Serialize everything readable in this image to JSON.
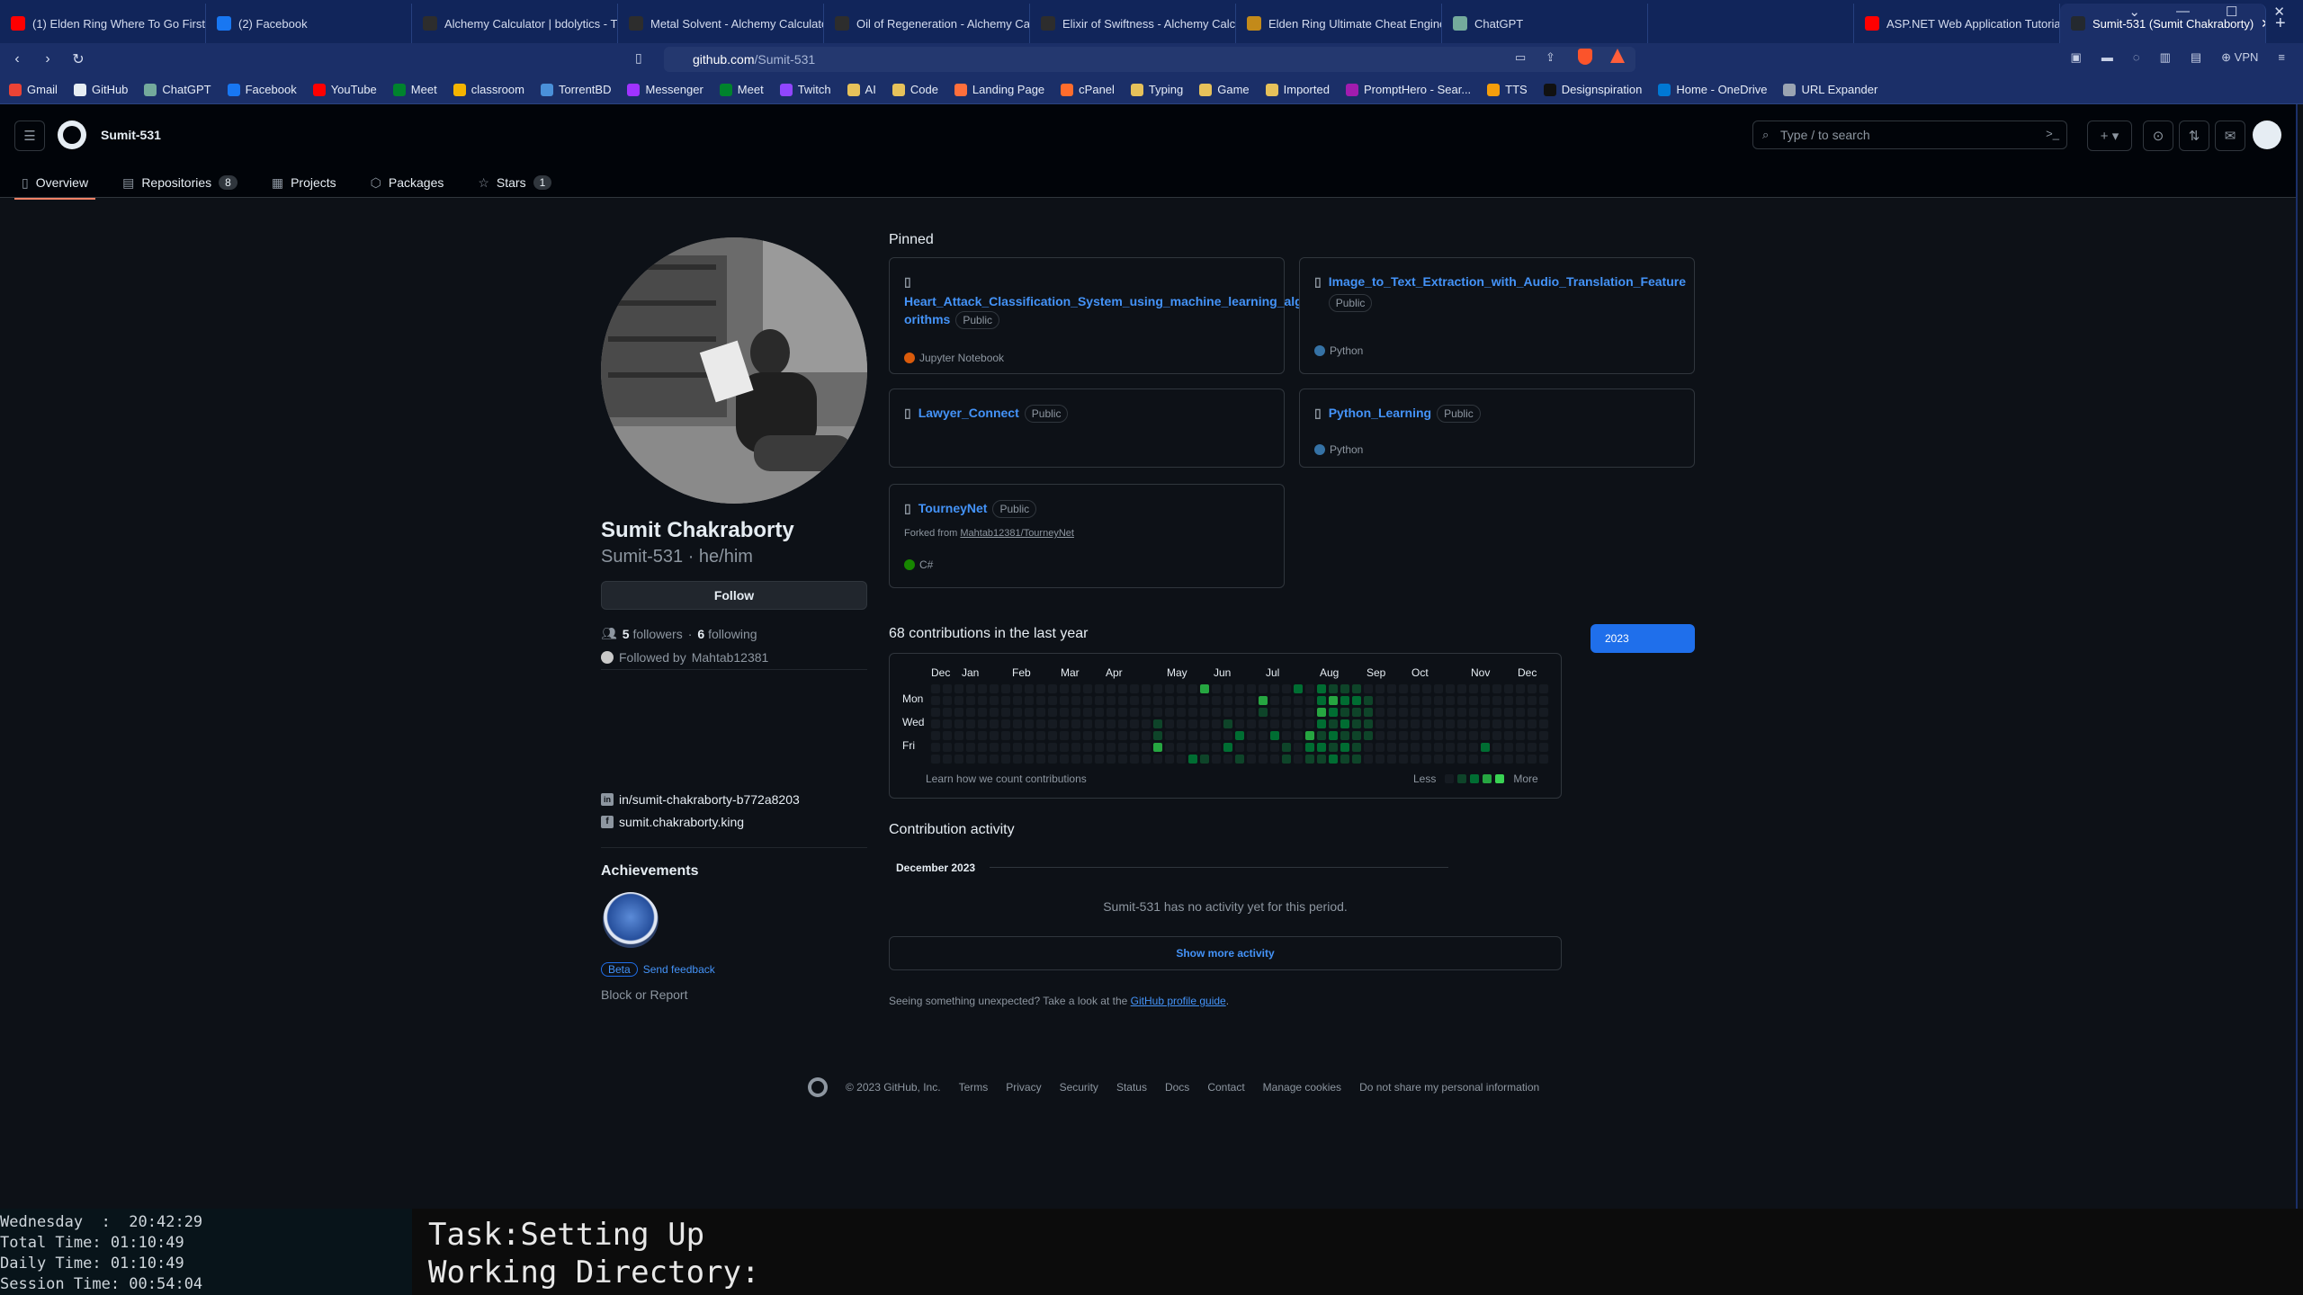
{
  "browser": {
    "tabs": [
      {
        "title": "(1) Elden Ring Where To Go First |",
        "favicon": "youtube-icon"
      },
      {
        "title": "(2) Facebook",
        "favicon": "facebook-icon"
      },
      {
        "title": "Alchemy Calculator | bdolytics - Th",
        "favicon": "bdolytics-icon"
      },
      {
        "title": "Metal Solvent - Alchemy Calculato",
        "favicon": "bdolytics-icon"
      },
      {
        "title": "Oil of Regeneration - Alchemy Cal",
        "favicon": "bdolytics-icon"
      },
      {
        "title": "Elixir of Swiftness - Alchemy Calcu",
        "favicon": "bdolytics-icon"
      },
      {
        "title": "Elden Ring Ultimate Cheat Engine",
        "favicon": "page-icon"
      },
      {
        "title": "ChatGPT",
        "favicon": "chatgpt-icon"
      },
      {
        "title": "",
        "favicon": ""
      },
      {
        "title": "ASP.NET Web Application Tutorial",
        "favicon": "youtube-icon"
      },
      {
        "title": "Sumit-531 (Sumit Chakraborty)",
        "favicon": "github-icon"
      }
    ],
    "url_host": "github.com",
    "url_path": "/Sumit-531",
    "vpn_label": "VPN",
    "bookmarks": [
      "Gmail",
      "GitHub",
      "ChatGPT",
      "Facebook",
      "YouTube",
      "Meet",
      "classroom",
      "TorrentBD",
      "Messenger",
      "Meet",
      "Twitch",
      "AI",
      "Code",
      "Landing Page",
      "cPanel",
      "Typing",
      "Game",
      "Imported",
      "PromptHero - Sear...",
      "TTS",
      "Designspiration",
      "Home - OneDrive",
      "URL Expander"
    ]
  },
  "github": {
    "username_top": "Sumit-531",
    "search_placeholder": "Type / to search",
    "tabs": [
      {
        "label": "Overview"
      },
      {
        "label": "Repositories",
        "count": "8"
      },
      {
        "label": "Projects"
      },
      {
        "label": "Packages"
      },
      {
        "label": "Stars",
        "count": "1"
      }
    ],
    "profile": {
      "fullname": "Sumit Chakraborty",
      "login": "Sumit-531 · he/him",
      "follow_label": "Follow",
      "followers_count": "5",
      "followers_label": "followers",
      "following_count": "6",
      "following_label": "following",
      "followed_by": "Followed by",
      "followed_by_user": "Mahtab12381",
      "linkedin": "in/sumit-chakraborty-b772a8203",
      "facebook": "sumit.chakraborty.king",
      "achievements_title": "Achievements",
      "beta_label": "Beta",
      "send_feedback": "Send feedback",
      "block_report": "Block or Report"
    },
    "pinned_title": "Pinned",
    "pinned": [
      {
        "name": "Heart_Attack_Classification_System_using_machine_learning_alg orithms",
        "visibility": "Public",
        "language": "Jupyter Notebook",
        "lang_color": "#da5b0b"
      },
      {
        "name": "Image_to_Text_Extraction_with_Audio_Translation_Feature",
        "visibility": "Public",
        "language": "Python",
        "lang_color": "#3572a5"
      },
      {
        "name": "Lawyer_Connect",
        "visibility": "Public",
        "language": "",
        "lang_color": ""
      },
      {
        "name": "Python_Learning",
        "visibility": "Public",
        "language": "Python",
        "lang_color": "#3572a5"
      },
      {
        "name": "TourneyNet",
        "visibility": "Public",
        "forked_label": "Forked from",
        "forked_from": "Mahtab12381/TourneyNet",
        "language": "C#",
        "lang_color": "#178600"
      }
    ],
    "contributions_title": "68 contributions in the last year",
    "year_button": "2023",
    "months": [
      "Dec",
      "Jan",
      "Feb",
      "Mar",
      "Apr",
      "May",
      "Jun",
      "Jul",
      "Aug",
      "Sep",
      "Oct",
      "Nov",
      "Dec"
    ],
    "days": [
      "Mon",
      "Wed",
      "Fri"
    ],
    "learn_link": "Learn how we count contributions",
    "less_label": "Less",
    "more_label": "More",
    "activity_title": "Contribution activity",
    "activity_month": "December 2023",
    "no_activity": "Sumit-531 has no activity yet for this period.",
    "show_more": "Show more activity",
    "unexpected_text": "Seeing something unexpected? Take a look at the",
    "profile_guide": "GitHub profile guide",
    "footer": [
      "© 2023 GitHub, Inc.",
      "Terms",
      "Privacy",
      "Security",
      "Status",
      "Docs",
      "Contact",
      "Manage cookies",
      "Do not share my personal information"
    ]
  },
  "terminal": {
    "left_lines": [
      "Wednesday  :  20:42:29",
      "Total Time: 01:10:49",
      "Daily Time: 01:10:49",
      "Session Time: 00:54:04"
    ],
    "task": "Task:Setting Up",
    "workdir": "Working Directory:"
  }
}
